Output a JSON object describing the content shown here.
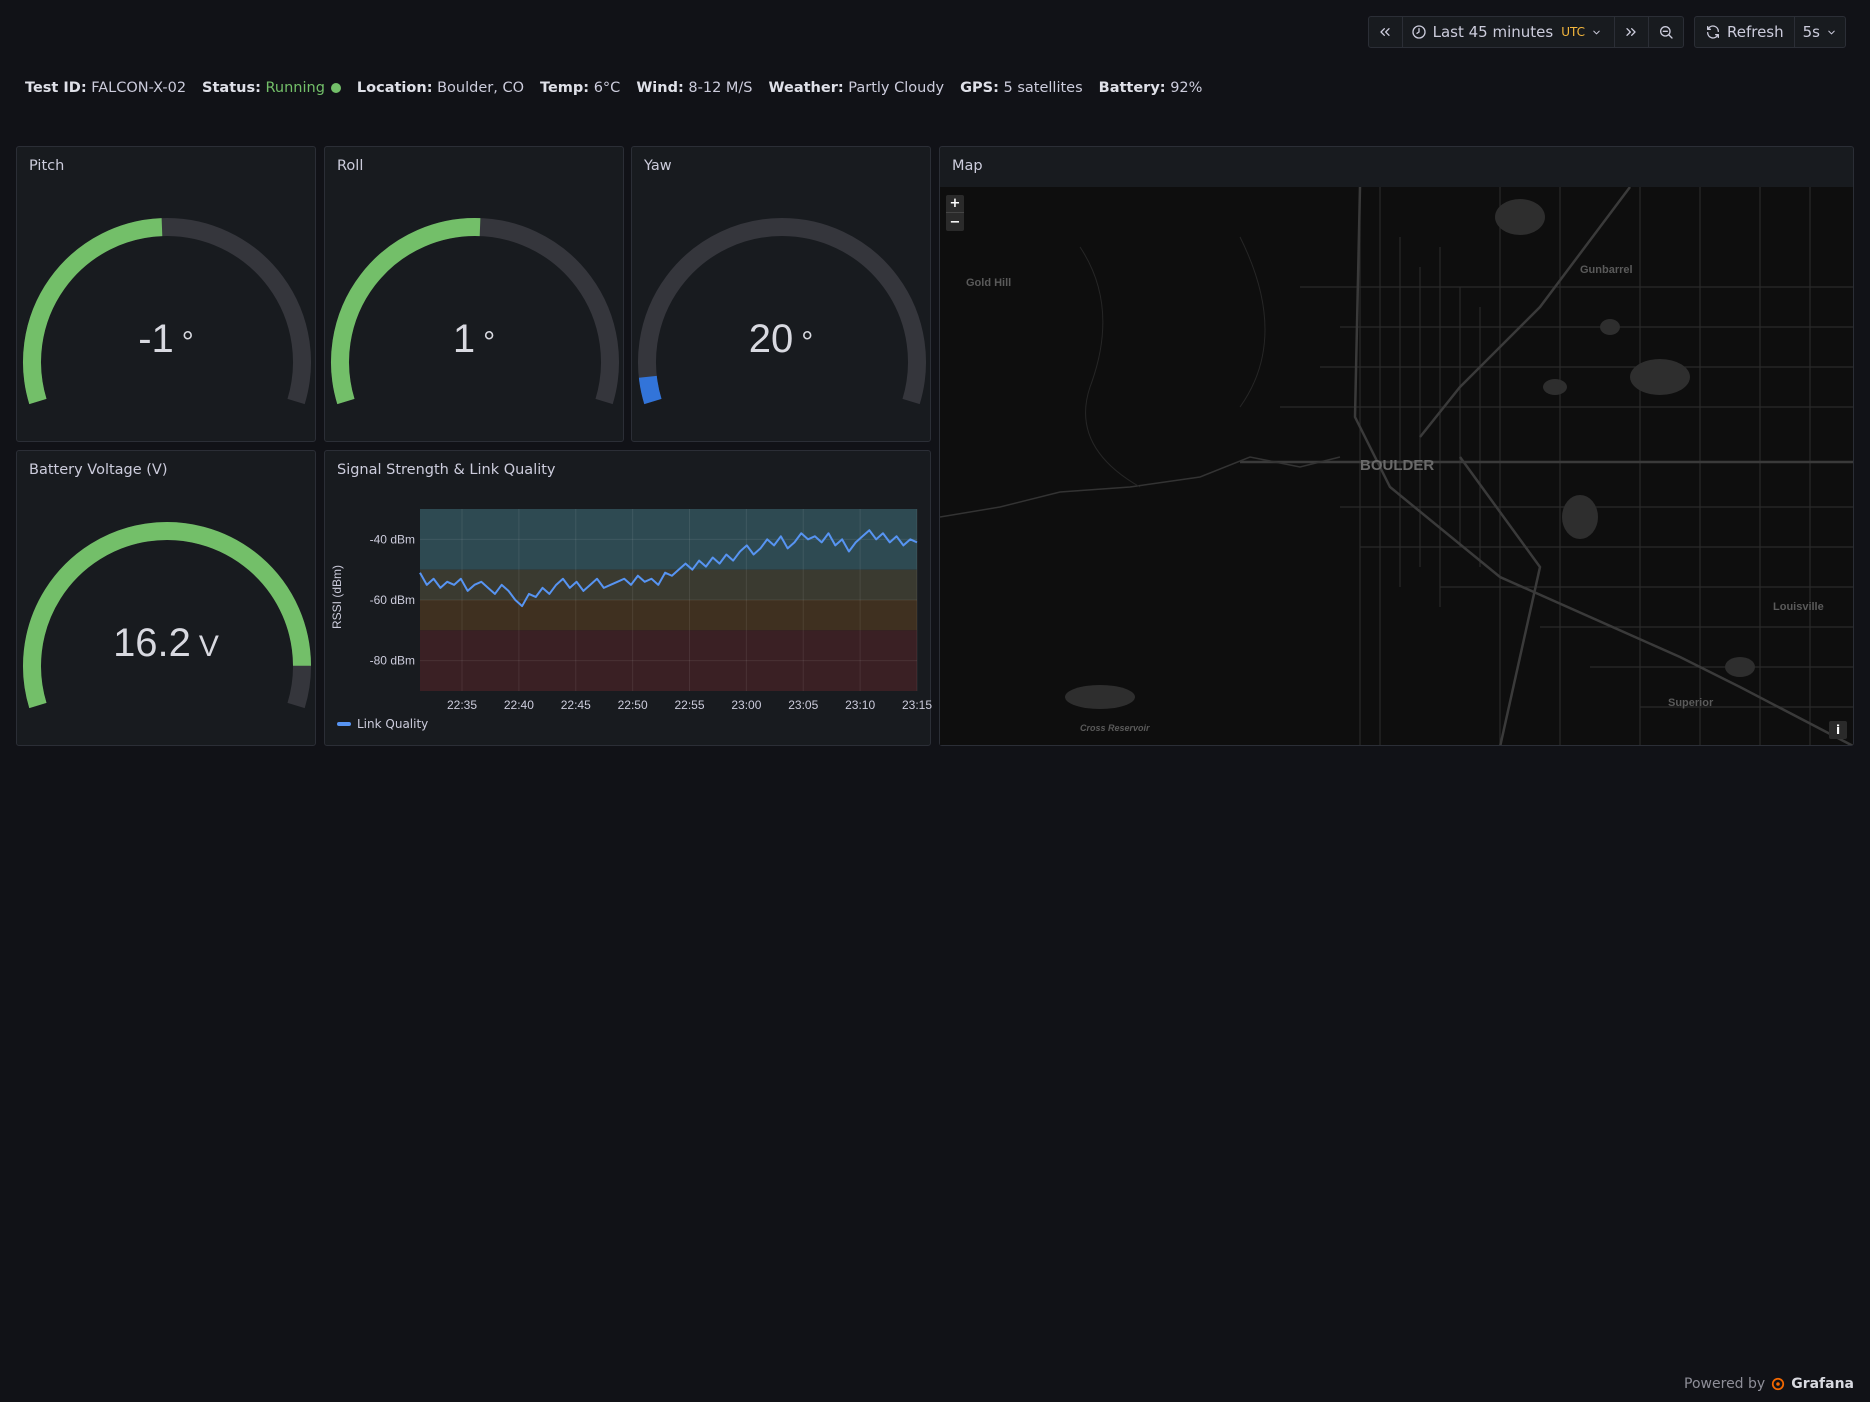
{
  "toolbar": {
    "time_range": "Last 45 minutes",
    "timezone": "UTC",
    "refresh_label": "Refresh",
    "refresh_interval": "5s"
  },
  "info": {
    "test_id_label": "Test ID:",
    "test_id": "FALCON-X-02",
    "status_label": "Status:",
    "status": "Running",
    "location_label": "Location:",
    "location": "Boulder, CO",
    "temp_label": "Temp:",
    "temp": "6°C",
    "wind_label": "Wind:",
    "wind": "8-12 M/S",
    "weather_label": "Weather:",
    "weather": "Partly Cloudy",
    "gps_label": "GPS:",
    "gps": "5 satellites",
    "battery_label": "Battery:",
    "battery": "92%"
  },
  "gauges": {
    "pitch": {
      "title": "Pitch",
      "value": "-1",
      "unit": "°",
      "fill_fraction": 0.49,
      "color": "#73bf69"
    },
    "roll": {
      "title": "Roll",
      "value": "1",
      "unit": "°",
      "fill_fraction": 0.51,
      "color": "#73bf69"
    },
    "yaw": {
      "title": "Yaw",
      "value": "20",
      "unit": "°",
      "fill_fraction": 0.05,
      "color": "#3274d9"
    },
    "battery": {
      "title": "Battery Voltage (V)",
      "value": "16.2",
      "unit": "V",
      "fill_fraction": 0.92,
      "color": "#73bf69"
    }
  },
  "signal": {
    "title": "Signal Strength & Link Quality",
    "ylabel": "RSSI (dBm)",
    "legend": "Link Quality",
    "chart_data": {
      "type": "line",
      "title": "Signal Strength & Link Quality",
      "ylabel": "RSSI (dBm)",
      "ylim": [
        -90,
        -30
      ],
      "yticks": [
        "-40 dBm",
        "-60 dBm",
        "-80 dBm"
      ],
      "ytick_values": [
        -40,
        -60,
        -80
      ],
      "xticks": [
        "22:35",
        "22:40",
        "22:45",
        "22:50",
        "22:55",
        "23:00",
        "23:05",
        "23:10",
        "23:15"
      ],
      "bands": [
        {
          "from": -30,
          "to": -50,
          "color": "#2e4a52"
        },
        {
          "from": -50,
          "to": -60,
          "color": "#3a3a30"
        },
        {
          "from": -60,
          "to": -70,
          "color": "#3f3020"
        },
        {
          "from": -70,
          "to": -90,
          "color": "#3a2024"
        }
      ],
      "series": [
        {
          "name": "Link Quality",
          "color": "#5794f2",
          "values": [
            -51,
            -55,
            -53,
            -56,
            -54,
            -55,
            -53,
            -57,
            -55,
            -54,
            -56,
            -58,
            -55,
            -57,
            -60,
            -62,
            -58,
            -59,
            -56,
            -58,
            -55,
            -53,
            -56,
            -54,
            -57,
            -55,
            -53,
            -56,
            -55,
            -54,
            -53,
            -55,
            -52,
            -54,
            -53,
            -55,
            -51,
            -52,
            -50,
            -48,
            -50,
            -47,
            -49,
            -46,
            -48,
            -45,
            -47,
            -44,
            -42,
            -45,
            -43,
            -40,
            -42,
            -39,
            -43,
            -41,
            -38,
            -40,
            -39,
            -41,
            -38,
            -42,
            -40,
            -44,
            -41,
            -39,
            -37,
            -40,
            -38,
            -41,
            -39,
            -42,
            -40,
            -41
          ]
        }
      ]
    }
  },
  "map": {
    "title": "Map",
    "zoom_in": "+",
    "zoom_out": "−",
    "info_btn": "i",
    "labels": [
      "Gold Hill",
      "Gunbarrel",
      "BOULDER",
      "Louisville",
      "Superior",
      "Cross Reservoir"
    ]
  },
  "footer": {
    "powered_by": "Powered by",
    "brand": "Grafana"
  }
}
